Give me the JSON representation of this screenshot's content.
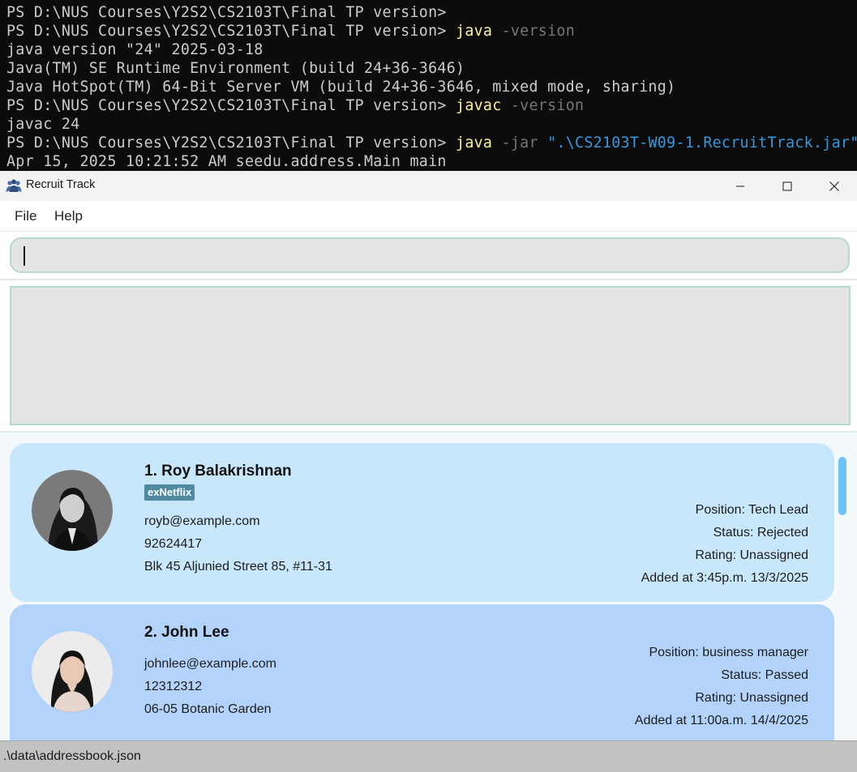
{
  "terminal": {
    "lines": [
      {
        "prompt": "PS D:\\NUS Courses\\Y2S2\\CS2103T\\Final TP version>",
        "cmd": "",
        "args": "",
        "str": ""
      },
      {
        "prompt": "PS D:\\NUS Courses\\Y2S2\\CS2103T\\Final TP version>",
        "cmd": "java",
        "args": "-version",
        "str": ""
      },
      {
        "prompt": "java version \"24\" 2025-03-18",
        "cmd": "",
        "args": "",
        "str": ""
      },
      {
        "prompt": "Java(TM) SE Runtime Environment (build 24+36-3646)",
        "cmd": "",
        "args": "",
        "str": ""
      },
      {
        "prompt": "Java HotSpot(TM) 64-Bit Server VM (build 24+36-3646, mixed mode, sharing)",
        "cmd": "",
        "args": "",
        "str": ""
      },
      {
        "prompt": "PS D:\\NUS Courses\\Y2S2\\CS2103T\\Final TP version>",
        "cmd": "javac",
        "args": "-version",
        "str": ""
      },
      {
        "prompt": "javac 24",
        "cmd": "",
        "args": "",
        "str": ""
      },
      {
        "prompt": "PS D:\\NUS Courses\\Y2S2\\CS2103T\\Final TP version>",
        "cmd": "java",
        "args": "-jar",
        "str": "\".\\CS2103T-W09-1.RecruitTrack.jar\""
      },
      {
        "prompt": "Apr 15, 2025 10:21:52 AM seedu.address.Main main",
        "cmd": "",
        "args": "",
        "str": ""
      }
    ]
  },
  "window": {
    "title": "Recruit Track",
    "icon": "people-group-icon"
  },
  "menu": {
    "file": "File",
    "help": "Help"
  },
  "command": {
    "value": ""
  },
  "result": {
    "text": ""
  },
  "candidates": [
    {
      "name": "1. Roy Balakrishnan",
      "tag": "exNetflix",
      "email": "royb@example.com",
      "phone": "92624417",
      "address": "Blk 45 Aljunied Street 85, #11-31",
      "position": "Position:  Tech Lead",
      "status": "Status:  Rejected",
      "rating": "Rating:  Unassigned",
      "added": "Added at 3:45p.m. 13/3/2025"
    },
    {
      "name": "2. John Lee",
      "tag": "",
      "email": "johnlee@example.com",
      "phone": "12312312",
      "address": "06-05 Botanic Garden",
      "position": "Position:  business manager",
      "status": "Status:  Passed",
      "rating": "Rating:  Unassigned",
      "added": "Added at 11:00a.m. 14/4/2025"
    }
  ],
  "status_bar": {
    "path": ".\\data\\addressbook.json"
  },
  "colors": {
    "card_1": "#c8e7fa",
    "card_2": "#b3d3fa",
    "tag": "#4f8aa0",
    "scroll_thumb": "#6cc4f4",
    "terminal_cmd": "#f9f1a5",
    "terminal_str": "#3a96dd"
  }
}
